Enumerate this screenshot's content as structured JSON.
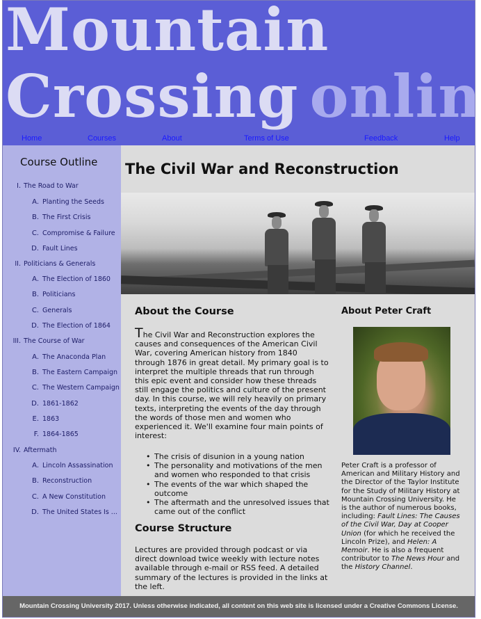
{
  "header": {
    "brand_word1": "Mountain",
    "brand_word2": "Crossing",
    "brand_word3": "online"
  },
  "nav": {
    "items": [
      {
        "label": "Home"
      },
      {
        "label": "Courses"
      },
      {
        "label": "About"
      },
      {
        "label": "Terms of Use"
      },
      {
        "label": "Feedback"
      },
      {
        "label": "Help"
      }
    ]
  },
  "sidebar": {
    "title": "Course Outline",
    "sections": [
      {
        "num": "I.",
        "label": "The Road to War",
        "items": [
          {
            "num": "A.",
            "label": "Planting the Seeds"
          },
          {
            "num": "B.",
            "label": "The First Crisis"
          },
          {
            "num": "C.",
            "label": "Compromise & Failure"
          },
          {
            "num": "D.",
            "label": "Fault Lines"
          }
        ]
      },
      {
        "num": "II.",
        "label": "Politicians & Generals",
        "items": [
          {
            "num": "A.",
            "label": "The Election of 1860"
          },
          {
            "num": "B.",
            "label": "Politicians"
          },
          {
            "num": "C.",
            "label": "Generals"
          },
          {
            "num": "D.",
            "label": "The Election of 1864"
          }
        ]
      },
      {
        "num": "III.",
        "label": "The Course of War",
        "items": [
          {
            "num": "A.",
            "label": "The Anaconda Plan"
          },
          {
            "num": "B.",
            "label": "The Eastern Campaign"
          },
          {
            "num": "C.",
            "label": "The Western Campaign"
          },
          {
            "num": "D.",
            "label": "1861-1862"
          },
          {
            "num": "E.",
            "label": "1863"
          },
          {
            "num": "F.",
            "label": "1864-1865"
          }
        ]
      },
      {
        "num": "IV.",
        "label": "Aftermath",
        "items": [
          {
            "num": "A.",
            "label": "Lincoln Assassination"
          },
          {
            "num": "B.",
            "label": "Reconstruction"
          },
          {
            "num": "C.",
            "label": "A New Constitution"
          },
          {
            "num": "D.",
            "label": "The United States Is ..."
          }
        ]
      }
    ]
  },
  "main": {
    "title": "The Civil War and Reconstruction",
    "about_course": {
      "heading": "About the Course",
      "dropcap": "T",
      "body": "he Civil War and Reconstruction explores the causes and consequences of the American Civil War, covering American history from 1840 through 1876 in great detail. My primary goal is to interpret the multiple threads that run through this epic event and consider how these threads still engage the politics and culture of the present day. In this course, we will rely heavily on primary texts, interpreting the events of the day through the words of those men and women who experienced it. We'll examine four main points of interest:",
      "points": [
        "The crisis of disunion in a young nation",
        "The personality and motivations of the men and women who responded to that crisis",
        "The events of the war which shaped the outcome",
        "The aftermath and the unresolved issues that came out of the conflict"
      ]
    },
    "course_structure": {
      "heading": "Course Structure",
      "body": "Lectures are provided through podcast or via direct download twice weekly with lecture notes available through e-mail or RSS feed. A detailed summary of the lectures is provided in the links at the left."
    },
    "bio": {
      "heading": "About Peter Craft",
      "text_1": "Peter Craft is a professor of American and Military History and the Director of the Taylor Institute for the Study of Military History at Mountain Crossing University. He is the author of numerous books, including: ",
      "book_1": "Fault Lines: The Causes of the Civil War, Day at Cooper Union",
      "text_2": " (for which he received the Lincoln Prize), and ",
      "book_2": "Helen: A Memoir",
      "text_3": ". He is also a frequent contributor to ",
      "show_1": "The News Hour",
      "text_4": " and the ",
      "show_2": "History Channel",
      "text_5": "."
    }
  },
  "footer": {
    "text": "Mountain Crossing University 2017. Unless otherwise indicated, all content on this web site is licensed under a Creative Commons License."
  }
}
